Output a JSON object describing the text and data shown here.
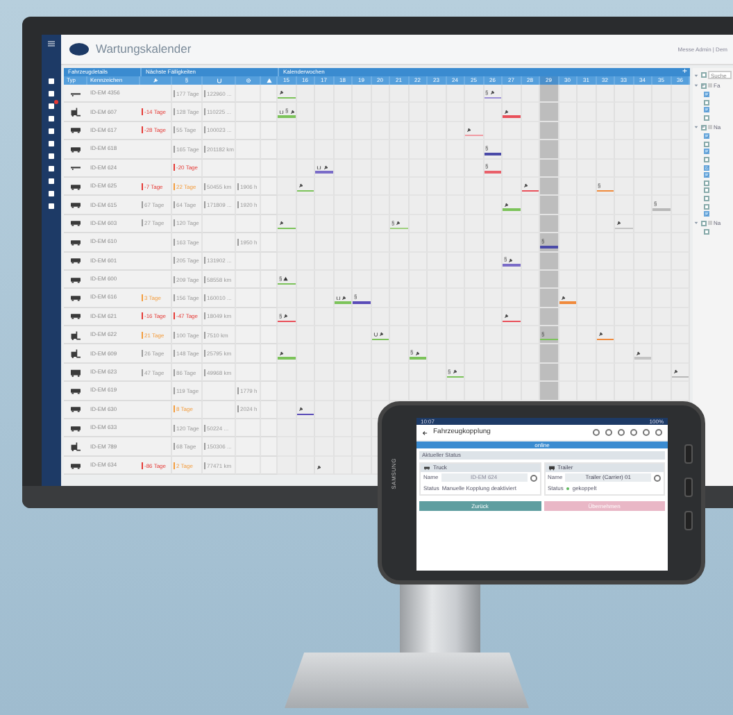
{
  "sidebar": {
    "items": [
      {
        "alert": false
      },
      {
        "alert": false
      },
      {
        "alert": true
      },
      {
        "alert": false
      },
      {
        "alert": false
      },
      {
        "alert": false
      },
      {
        "alert": false
      },
      {
        "alert": false
      },
      {
        "alert": false
      },
      {
        "alert": false
      },
      {
        "alert": false
      }
    ]
  },
  "window": {
    "title": "Wartungskalender",
    "user": "Messe Admin | Dem"
  },
  "table": {
    "groups": [
      "Fahrzeugdetails",
      "Nächste Fälligkeiten",
      "Kalenderwochen"
    ],
    "add_label": "+",
    "columns": [
      "Typ",
      "Kennzeichen"
    ],
    "due_columns": [
      {
        "kind": "wrench"
      },
      {
        "kind": "text",
        "label": "§"
      },
      {
        "kind": "tire"
      },
      {
        "kind": "gear"
      },
      {
        "kind": "warning"
      }
    ],
    "weeks": [
      {
        "label": "15",
        "current": false
      },
      {
        "label": "16",
        "current": false
      },
      {
        "label": "17",
        "current": false
      },
      {
        "label": "18",
        "current": false
      },
      {
        "label": "19",
        "current": false
      },
      {
        "label": "20",
        "current": false
      },
      {
        "label": "21",
        "current": false
      },
      {
        "label": "22",
        "current": false
      },
      {
        "label": "23",
        "current": false
      },
      {
        "label": "24",
        "current": false
      },
      {
        "label": "25",
        "current": false
      },
      {
        "label": "26",
        "current": false
      },
      {
        "label": "27",
        "current": false
      },
      {
        "label": "28",
        "current": false
      },
      {
        "label": "29",
        "current": true
      },
      {
        "label": "30",
        "current": false
      },
      {
        "label": "31",
        "current": false
      },
      {
        "label": "32",
        "current": false
      },
      {
        "label": "33",
        "current": false
      },
      {
        "label": "34",
        "current": false
      },
      {
        "label": "35",
        "current": false
      },
      {
        "label": "36",
        "current": false
      }
    ],
    "rows": [
      {
        "kind": "trailer",
        "plate": "ID-EM 4356",
        "column_4": {
          "text": "177 Tage",
          "color": "#9a9a9a"
        },
        "column_5": {
          "text": "122960 ...",
          "color": "#9a9a9a"
        },
        "calendar": {
          "column_8": {
            "color": "#7cc35a",
            "marks": [
              {
                "kind": "wrench"
              }
            ]
          },
          "column_19": {
            "color": "#9b8fd6",
            "marks": [
              {
                "kind": "text",
                "label": "§"
              },
              {
                "kind": "wrench"
              }
            ]
          }
        }
      },
      {
        "kind": "forklift",
        "plate": "ID-EM 607",
        "column_3": {
          "text": "-14 Tage",
          "color": "#e53935"
        },
        "column_4": {
          "text": "128 Tage",
          "color": "#9a9a9a"
        },
        "column_5": {
          "text": "110225 ...",
          "color": "#9a9a9a"
        },
        "calendar": {
          "column_8": {
            "color": "#7cc35a",
            "marks": [
              {
                "kind": "tire"
              },
              {
                "kind": "text",
                "label": "§"
              },
              {
                "kind": "wrench"
              }
            ]
          },
          "column_20": {
            "color": "#e9505a",
            "marks": [
              {
                "kind": "wrench"
              }
            ]
          }
        }
      },
      {
        "kind": "truck",
        "plate": "ID-EM 617",
        "column_3": {
          "text": "-28 Tage",
          "color": "#e53935"
        },
        "column_4": {
          "text": "55 Tage",
          "color": "#9a9a9a"
        },
        "column_5": {
          "text": "100023 ...",
          "color": "#9a9a9a"
        },
        "calendar": {
          "column_18": {
            "color": "#f09aa2",
            "marks": [
              {
                "kind": "wrench"
              }
            ]
          }
        }
      },
      {
        "kind": "truck",
        "plate": "ID-EM 618",
        "column_4": {
          "text": "165 Tage",
          "color": "#9a9a9a"
        },
        "column_5": {
          "text": "201182 km",
          "color": "#9a9a9a"
        },
        "calendar": {
          "column_19": {
            "color": "#4a4aa8",
            "marks": [
              {
                "kind": "text",
                "label": "§"
              }
            ]
          }
        }
      },
      {
        "kind": "trailer",
        "plate": "ID-EM 624",
        "column_4": {
          "text": "-20 Tage",
          "color": "#e53935"
        },
        "calendar": {
          "column_10": {
            "color": "#7a6cc8",
            "marks": [
              {
                "kind": "tire"
              },
              {
                "kind": "wrench"
              }
            ]
          },
          "column_19": {
            "color": "#e9606a",
            "marks": [
              {
                "kind": "text",
                "label": "§"
              }
            ]
          }
        }
      },
      {
        "kind": "truck",
        "plate": "ID-EM 625",
        "column_3": {
          "text": "-7 Tage",
          "color": "#e53935"
        },
        "column_4": {
          "text": "22 Tage",
          "color": "#f39c3d"
        },
        "column_5": {
          "text": "50455 km",
          "color": "#9a9a9a"
        },
        "column_6": {
          "text": "1906 h",
          "color": "#9a9a9a"
        },
        "calendar": {
          "column_9": {
            "color": "#7cc35a",
            "marks": [
              {
                "kind": "wrench"
              }
            ]
          },
          "column_21": {
            "color": "#e9505a",
            "marks": [
              {
                "kind": "wrench"
              }
            ]
          },
          "column_25": {
            "color": "#f08a3c",
            "marks": [
              {
                "kind": "text",
                "label": "§"
              }
            ]
          }
        }
      },
      {
        "kind": "truck",
        "plate": "ID-EM 615",
        "column_3": {
          "text": "67 Tage",
          "color": "#9a9a9a"
        },
        "column_4": {
          "text": "64 Tage",
          "color": "#9a9a9a"
        },
        "column_5": {
          "text": "171809 ...",
          "color": "#9a9a9a"
        },
        "column_6": {
          "text": "1920 h",
          "color": "#9a9a9a"
        },
        "calendar": {
          "column_20": {
            "color": "#7cc35a",
            "marks": [
              {
                "kind": "wrench"
              }
            ]
          },
          "column_28": {
            "color": "#b8b8b8",
            "marks": [
              {
                "kind": "text",
                "label": "§"
              }
            ]
          }
        }
      },
      {
        "kind": "truck",
        "plate": "ID-EM 603",
        "column_3": {
          "text": "27 Tage",
          "color": "#9a9a9a"
        },
        "column_4": {
          "text": "120 Tage",
          "color": "#9a9a9a"
        },
        "calendar": {
          "column_8": {
            "color": "#7cc35a",
            "marks": [
              {
                "kind": "wrench"
              }
            ]
          },
          "column_14": {
            "color": "#9fd07e",
            "marks": [
              {
                "kind": "text",
                "label": "§"
              },
              {
                "kind": "wrench"
              }
            ]
          },
          "column_26": {
            "color": "#c4c4c4",
            "marks": [
              {
                "kind": "wrench"
              }
            ]
          }
        }
      },
      {
        "kind": "truck",
        "plate": "ID-EM 610",
        "column_4": {
          "text": "163 Tage",
          "color": "#9a9a9a"
        },
        "column_6": {
          "text": "1950 h",
          "color": "#9a9a9a"
        },
        "calendar": {
          "column_22": {
            "color": "#4a4aa8",
            "marks": [
              {
                "kind": "text",
                "label": "§"
              }
            ]
          }
        }
      },
      {
        "kind": "truck",
        "plate": "ID-EM 601",
        "column_4": {
          "text": "205 Tage",
          "color": "#9a9a9a"
        },
        "column_5": {
          "text": "131902 ...",
          "color": "#9a9a9a"
        },
        "calendar": {
          "column_20": {
            "color": "#7a6cc8",
            "marks": [
              {
                "kind": "text",
                "label": "§"
              },
              {
                "kind": "wrench"
              }
            ]
          }
        }
      },
      {
        "kind": "truck",
        "plate": "ID-EM 600",
        "column_4": {
          "text": "209 Tage",
          "color": "#9a9a9a"
        },
        "column_5": {
          "text": "58558 km",
          "color": "#9a9a9a"
        },
        "calendar": {
          "column_8": {
            "color": "#7cc35a",
            "marks": [
              {
                "kind": "text",
                "label": "§"
              },
              {
                "kind": "warning"
              }
            ]
          }
        }
      },
      {
        "kind": "truck",
        "plate": "ID-EM 616",
        "column_3": {
          "text": "3 Tage",
          "color": "#f39c3d"
        },
        "column_4": {
          "text": "156 Tage",
          "color": "#9a9a9a"
        },
        "column_5": {
          "text": "160010 ...",
          "color": "#9a9a9a"
        },
        "calendar": {
          "column_11": {
            "color": "#7cc35a",
            "marks": [
              {
                "kind": "tire"
              },
              {
                "kind": "wrench"
              }
            ]
          },
          "column_12": {
            "color": "#5a4cb8",
            "marks": [
              {
                "kind": "text",
                "label": "§"
              }
            ]
          },
          "column_23": {
            "color": "#f08a3c",
            "marks": [
              {
                "kind": "wrench"
              }
            ]
          }
        }
      },
      {
        "kind": "truck",
        "plate": "ID-EM 621",
        "column_3": {
          "text": "-16 Tage",
          "color": "#e53935"
        },
        "column_4": {
          "text": "-47 Tage",
          "color": "#e53935"
        },
        "column_5": {
          "text": "18049 km",
          "color": "#9a9a9a"
        },
        "calendar": {
          "column_8": {
            "color": "#e9505a",
            "marks": [
              {
                "kind": "text",
                "label": "§"
              },
              {
                "kind": "wrench"
              }
            ]
          },
          "column_20": {
            "color": "#e9505a",
            "marks": [
              {
                "kind": "wrench"
              }
            ]
          }
        }
      },
      {
        "kind": "forklift",
        "plate": "ID-EM 622",
        "column_3": {
          "text": "21 Tage",
          "color": "#f39c3d"
        },
        "column_4": {
          "text": "100 Tage",
          "color": "#9a9a9a"
        },
        "column_5": {
          "text": "7510 km",
          "color": "#9a9a9a"
        },
        "calendar": {
          "column_13": {
            "color": "#7cc35a",
            "marks": [
              {
                "kind": "tire"
              },
              {
                "kind": "wrench"
              }
            ]
          },
          "column_22": {
            "color": "#7cc35a",
            "marks": [
              {
                "kind": "text",
                "label": "§"
              }
            ]
          },
          "column_25": {
            "color": "#f08a3c",
            "marks": [
              {
                "kind": "wrench"
              }
            ]
          }
        }
      },
      {
        "kind": "forklift",
        "plate": "ID-EM 609",
        "column_3": {
          "text": "26 Tage",
          "color": "#9a9a9a"
        },
        "column_4": {
          "text": "148 Tage",
          "color": "#9a9a9a"
        },
        "column_5": {
          "text": "25795 km",
          "color": "#9a9a9a"
        },
        "calendar": {
          "column_8": {
            "color": "#7cc35a",
            "marks": [
              {
                "kind": "wrench"
              }
            ]
          },
          "column_15": {
            "color": "#7cc35a",
            "marks": [
              {
                "kind": "text",
                "label": "§"
              },
              {
                "kind": "wrench"
              }
            ]
          },
          "column_27": {
            "color": "#c4c4c4",
            "marks": [
              {
                "kind": "wrench"
              }
            ]
          }
        }
      },
      {
        "kind": "boxtruck",
        "plate": "ID-EM 623",
        "column_3": {
          "text": "47 Tage",
          "color": "#9a9a9a"
        },
        "column_4": {
          "text": "86 Tage",
          "color": "#9a9a9a"
        },
        "column_5": {
          "text": "49968 km",
          "color": "#9a9a9a"
        },
        "calendar": {
          "column_17": {
            "color": "#7cc35a",
            "marks": [
              {
                "kind": "text",
                "label": "§"
              },
              {
                "kind": "wrench"
              }
            ]
          },
          "column_29": {
            "color": "#b8b8b8",
            "marks": [
              {
                "kind": "wrench"
              }
            ]
          }
        }
      },
      {
        "kind": "truck",
        "plate": "ID-EM 619",
        "column_4": {
          "text": "119 Tage",
          "color": "#9a9a9a"
        },
        "column_6": {
          "text": "1779 h",
          "color": "#9a9a9a"
        }
      },
      {
        "kind": "truck",
        "plate": "ID-EM 630",
        "column_4": {
          "text": "8 Tage",
          "color": "#f39c3d"
        },
        "column_6": {
          "text": "2024 h",
          "color": "#9a9a9a"
        },
        "calendar": {
          "column_9": {
            "color": "#5a4cb8",
            "marks": [
              {
                "kind": "wrench"
              }
            ]
          }
        }
      },
      {
        "kind": "truck",
        "plate": "ID-EM 633",
        "column_4": {
          "text": "120 Tage",
          "color": "#9a9a9a"
        },
        "column_5": {
          "text": "50224 ...",
          "color": "#9a9a9a"
        }
      },
      {
        "kind": "forklift",
        "plate": "ID-EM 789",
        "column_4": {
          "text": "68 Tage",
          "color": "#9a9a9a"
        },
        "column_5": {
          "text": "150306 ...",
          "color": "#9a9a9a"
        }
      },
      {
        "kind": "truck",
        "plate": "ID-EM 634",
        "column_3": {
          "text": "-86 Tage",
          "color": "#e53935"
        },
        "column_4": {
          "text": "2 Tage",
          "color": "#f39c3d"
        },
        "column_5": {
          "text": "77471 km",
          "color": "#9a9a9a"
        },
        "calendar": {
          "column_10": {
            "marks": [
              {
                "kind": "wrench"
              }
            ]
          }
        }
      }
    ]
  },
  "filter": {
    "placeholder": "Suche",
    "all_checked": false,
    "groups": [
      {
        "label": "Fa",
        "expanded": true,
        "checked": false,
        "partial": true,
        "children": [
          {
            "checked": true
          },
          {
            "checked": false
          },
          {
            "checked": true
          },
          {
            "checked": false
          }
        ]
      },
      {
        "label": "Na",
        "expanded": true,
        "checked": false,
        "partial": true,
        "children": [
          {
            "checked": true
          },
          {
            "checked": false
          },
          {
            "checked": true
          },
          {
            "checked": false
          },
          {
            "checked": true
          },
          {
            "checked": true
          },
          {
            "checked": false
          },
          {
            "checked": false
          },
          {
            "checked": false
          },
          {
            "checked": false
          },
          {
            "checked": true
          }
        ]
      },
      {
        "label": "Na",
        "expanded": true,
        "checked": false,
        "partial": false,
        "children": [
          {
            "checked": false
          }
        ]
      }
    ]
  },
  "tablet": {
    "brand": "SAMSUNG",
    "status_time": "10:07",
    "battery": "100%",
    "title": "Fahrzeugkopplung",
    "connection": "online",
    "section": "Aktueller Status",
    "cards": [
      {
        "kind": "truck",
        "title": "Truck",
        "name_label": "Name",
        "name_value": "ID-EM 624",
        "disabled": true,
        "status_label": "Status",
        "status_value": "Manuelle Kopplung deaktiviert"
      },
      {
        "kind": "trailer",
        "title": "Trailer",
        "name_label": "Name",
        "name_value": "Trailer (Carrier) 01",
        "disabled": false,
        "status_label": "Status",
        "status_value": "gekoppelt",
        "color": "#5cb85c"
      }
    ],
    "buttons": [
      {
        "label": "Zurück",
        "disabled": false
      },
      {
        "label": "Übernehmen",
        "disabled": true
      }
    ]
  }
}
